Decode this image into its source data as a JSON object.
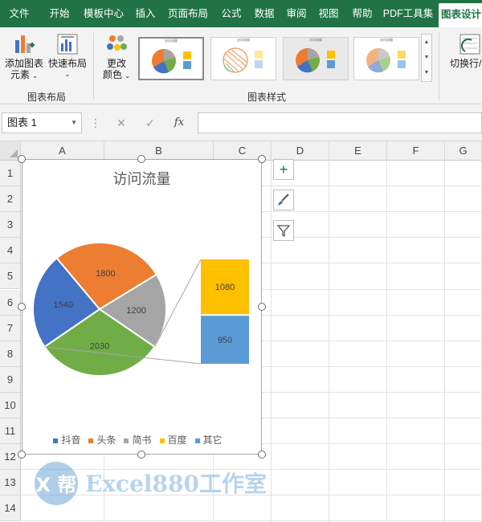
{
  "menu": {
    "tabs": [
      {
        "label": "文件"
      },
      {
        "label": "开始"
      },
      {
        "label": "模板中心"
      },
      {
        "label": "插入"
      },
      {
        "label": "页面布局"
      },
      {
        "label": "公式"
      },
      {
        "label": "数据"
      },
      {
        "label": "审阅"
      },
      {
        "label": "视图"
      },
      {
        "label": "帮助"
      },
      {
        "label": "PDF工具集"
      },
      {
        "label": "图表设计"
      }
    ]
  },
  "ribbon": {
    "add_element": {
      "line1": "添加图表",
      "line2": "元素"
    },
    "quick_layout": {
      "line1": "快速布局"
    },
    "change_colors": {
      "line1": "更改",
      "line2": "颜色"
    },
    "switch_rowcol": {
      "line1": "切换行/"
    },
    "group_layout": "图表布局",
    "group_styles": "图表样式",
    "thumb_titles": [
      "访问流量",
      "访问流量",
      "访问流量",
      "访问流量"
    ]
  },
  "formula_bar": {
    "name_box": "图表 1",
    "fx": "fx",
    "cancel": "✕",
    "enter": "✓",
    "menu_dots": "⋮",
    "formula_value": ""
  },
  "grid": {
    "columns": [
      "A",
      "B",
      "C",
      "D",
      "E",
      "F",
      "G"
    ],
    "rows": [
      "1",
      "2",
      "3",
      "4",
      "5",
      "6",
      "7",
      "8",
      "9",
      "10",
      "11",
      "12",
      "13",
      "14"
    ]
  },
  "chart_data": {
    "type": "pie",
    "title": "访问流量",
    "categories": [
      "抖音",
      "头条",
      "简书",
      "百度",
      "其它"
    ],
    "values": [
      1540,
      1800,
      1200,
      1080,
      950
    ],
    "pie_values": [
      1540,
      1800,
      1200,
      2030
    ],
    "pie_labels": [
      "1540",
      "1800",
      "1200",
      "2030"
    ],
    "secondary_values": [
      1080,
      950
    ],
    "secondary_labels": [
      "1080",
      "950"
    ],
    "colors": [
      "#4472C4",
      "#ED7D31",
      "#A5A5A5",
      "#FFC000",
      "#5B9BD5",
      "#70AD47"
    ],
    "legend_position": "bottom",
    "subtype": "bar-of-pie"
  },
  "chart_side_buttons": {
    "add": "+",
    "style": "brush",
    "filter": "funnel"
  },
  "watermark": {
    "text": "Excel880工作室",
    "badge": "X 帮"
  }
}
